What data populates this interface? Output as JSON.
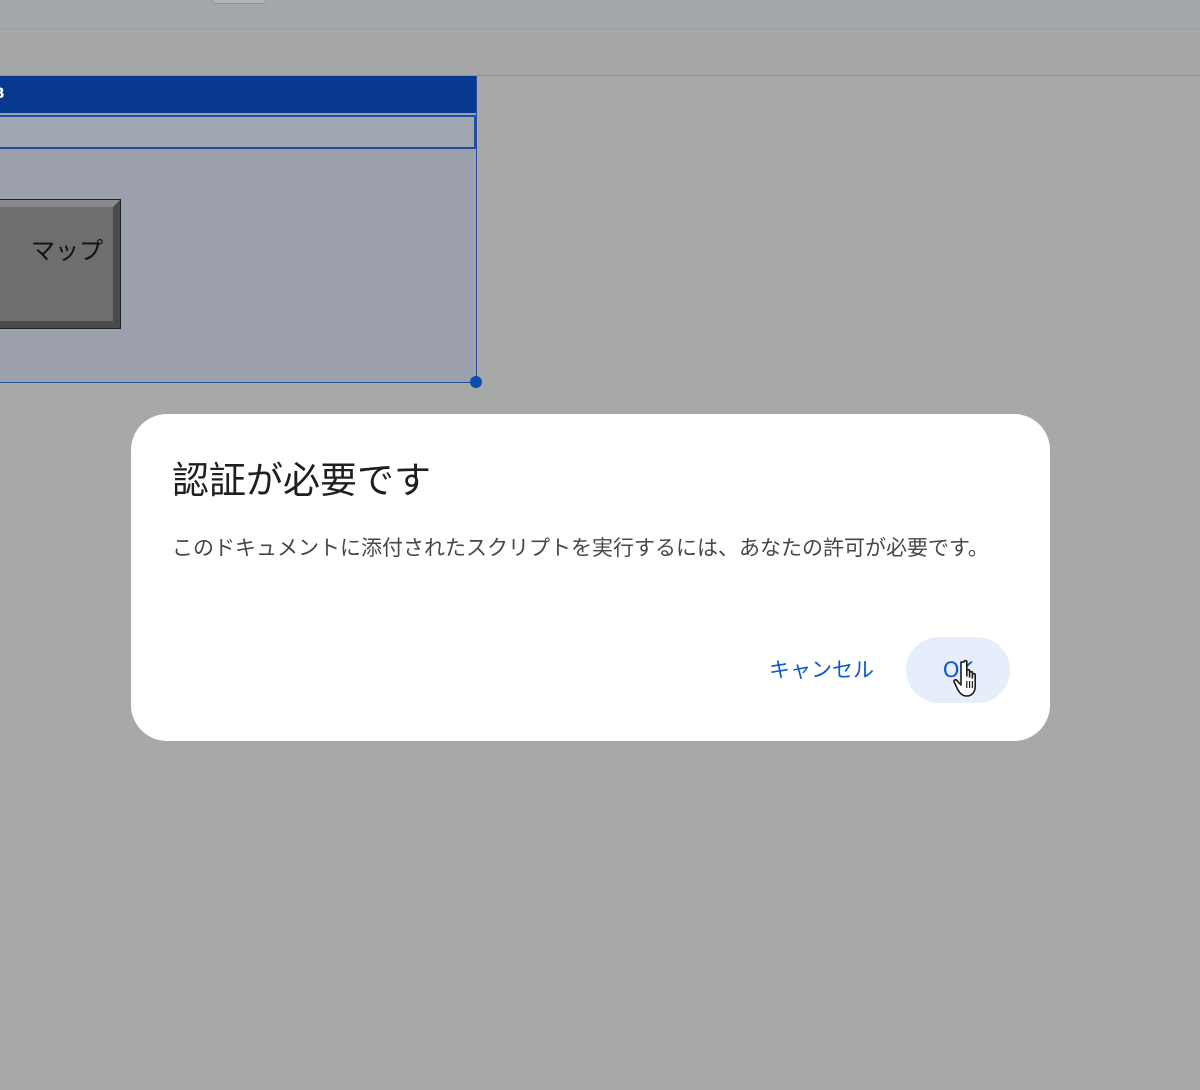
{
  "background_sheet": {
    "frame_title": "B",
    "map_button_label": "マップ"
  },
  "dialog": {
    "title": "認証が必要です",
    "message": "このドキュメントに添付されたスクリプトを実行するには、あなたの許可が必要です。",
    "cancel_label": "キャンセル",
    "ok_label": "OK"
  },
  "colors": {
    "overlay": "#a7a9a8",
    "frame_title_bg": "#07398e",
    "dialog_bg": "#ffffff",
    "button_text": "#0b57d0",
    "ok_button_bg": "#e6edfb"
  },
  "icons": {
    "cursor": "hand-pointer-icon"
  }
}
